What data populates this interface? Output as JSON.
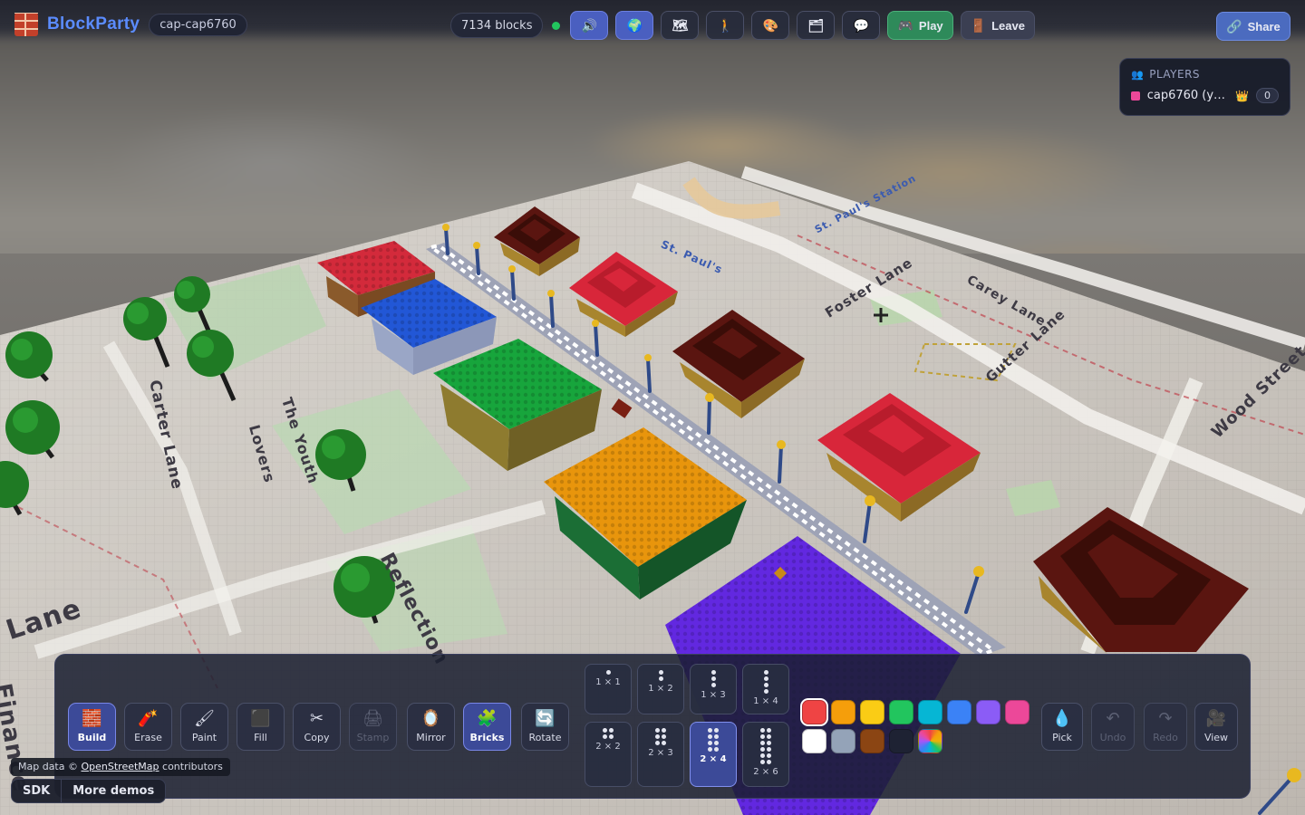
{
  "app": {
    "name": "BlockParty",
    "room": "cap-cap6760"
  },
  "topbar": {
    "block_count": "7134 blocks",
    "status": "connected",
    "icons": [
      "speaker-icon",
      "globe-icon",
      "map-icon",
      "walk-icon",
      "palette-icon",
      "folder-icon",
      "chat-icon"
    ],
    "play_label": "Play",
    "leave_label": "Leave",
    "share_label": "Share"
  },
  "players": {
    "title": "PLAYERS",
    "list": [
      {
        "name": "cap6760 (y…",
        "color": "#ec4899",
        "score": "0"
      }
    ]
  },
  "tools": [
    {
      "label": "Build",
      "icon": "brick-icon",
      "active": true
    },
    {
      "label": "Erase",
      "icon": "dynamite-icon"
    },
    {
      "label": "Paint",
      "icon": "paintbrush-icon"
    },
    {
      "label": "Fill",
      "icon": "fill-square-icon"
    },
    {
      "label": "Copy",
      "icon": "scissors-icon"
    },
    {
      "label": "Stamp",
      "icon": "stamp-icon",
      "disabled": true
    },
    {
      "label": "Mirror",
      "icon": "mirror-icon"
    },
    {
      "label": "Bricks",
      "icon": "puzzle-icon",
      "active": true
    },
    {
      "label": "Rotate",
      "icon": "rotate-icon"
    }
  ],
  "bricks": [
    {
      "label": "1 × 1",
      "cols": 1,
      "rows": 1
    },
    {
      "label": "1 × 2",
      "cols": 1,
      "rows": 2
    },
    {
      "label": "1 × 3",
      "cols": 1,
      "rows": 3
    },
    {
      "label": "1 × 4",
      "cols": 1,
      "rows": 4
    },
    {
      "label": "2 × 2",
      "cols": 2,
      "rows": 2
    },
    {
      "label": "2 × 3",
      "cols": 2,
      "rows": 3
    },
    {
      "label": "2 × 4",
      "cols": 2,
      "rows": 4,
      "active": true
    },
    {
      "label": "2 × 6",
      "cols": 2,
      "rows": 6
    }
  ],
  "colors": [
    "#ef4444",
    "#f59e0b",
    "#facc15",
    "#22c55e",
    "#06b6d4",
    "#3b82f6",
    "#8b5cf6",
    "#ec4899",
    "#ffffff",
    "#94a3b8",
    "#8b4513",
    "#1e2233",
    "rainbow"
  ],
  "selected_color": "#ef4444",
  "actions": [
    {
      "label": "Pick",
      "icon": "droplet-icon"
    },
    {
      "label": "Undo",
      "icon": "undo-icon",
      "disabled": true
    },
    {
      "label": "Redo",
      "icon": "redo-icon",
      "disabled": true
    },
    {
      "label": "View",
      "icon": "camera-icon"
    }
  ],
  "footer": {
    "attribution_prefix": "Map data ©",
    "attribution_link": "OpenStreetMap",
    "attribution_suffix": "contributors",
    "sdk_label": "SDK",
    "demos_label": "More demos"
  },
  "map_labels": [
    "St. Paul's",
    "St. Paul's Station",
    "Foster Lane",
    "Carey Lane",
    "Gutter Lane",
    "Wood Street",
    "Carter Lane",
    "Lovers",
    "The Youth",
    "Reflection",
    "Lane",
    "Finance"
  ]
}
